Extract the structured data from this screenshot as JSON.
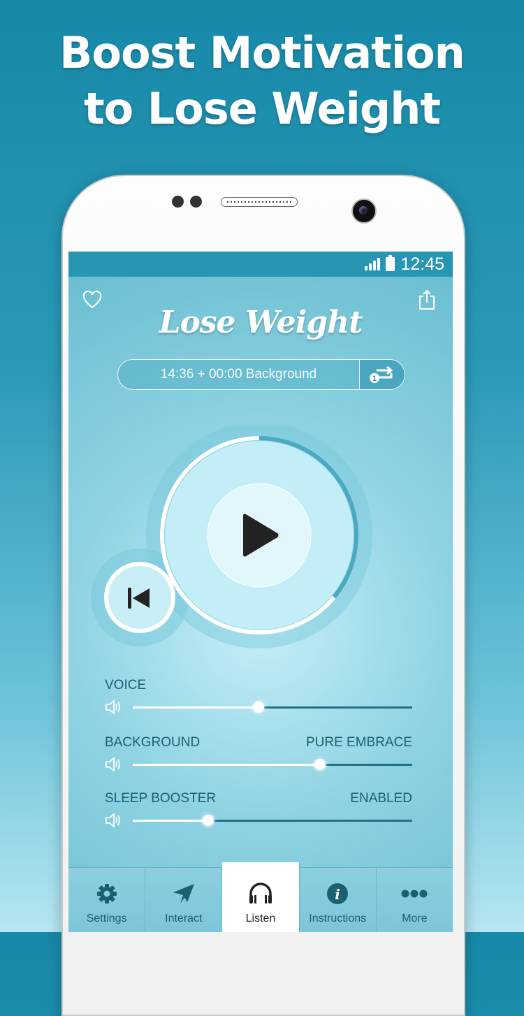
{
  "promo": {
    "headline_line1": "Boost Motivation",
    "headline_line2": "to Lose Weight"
  },
  "colors": {
    "accent": "#2895b3",
    "label_dark": "#1c5f73",
    "background_top": "#1789a8"
  },
  "status_bar": {
    "time": "12:45",
    "signal_icon": "signal-icon",
    "battery_icon": "battery-icon"
  },
  "header": {
    "title": "Lose Weight",
    "favorite_icon": "heart-icon",
    "share_icon": "share-icon"
  },
  "session": {
    "duration_text": "14:36 + 00:00 Background",
    "repeat_icon": "repeat-one-icon",
    "repeat_count": "1"
  },
  "player": {
    "play_icon": "play-icon",
    "previous_icon": "skip-previous-icon",
    "progress_fraction": 0.64
  },
  "sliders": [
    {
      "label": "VOICE",
      "value_label": "",
      "level": 0.45,
      "icon": "volume-icon"
    },
    {
      "label": "BACKGROUND",
      "value_label": "PURE EMBRACE",
      "level": 0.67,
      "icon": "volume-icon"
    },
    {
      "label": "SLEEP BOOSTER",
      "value_label": "ENABLED",
      "level": 0.27,
      "icon": "volume-icon"
    }
  ],
  "tabs": [
    {
      "label": "Settings",
      "icon": "gear-icon",
      "active": false
    },
    {
      "label": "Interact",
      "icon": "paper-plane-icon",
      "active": false
    },
    {
      "label": "Listen",
      "icon": "headphones-icon",
      "active": true
    },
    {
      "label": "Instructions",
      "icon": "info-icon",
      "active": false
    },
    {
      "label": "More",
      "icon": "more-dots-icon",
      "active": false
    }
  ]
}
